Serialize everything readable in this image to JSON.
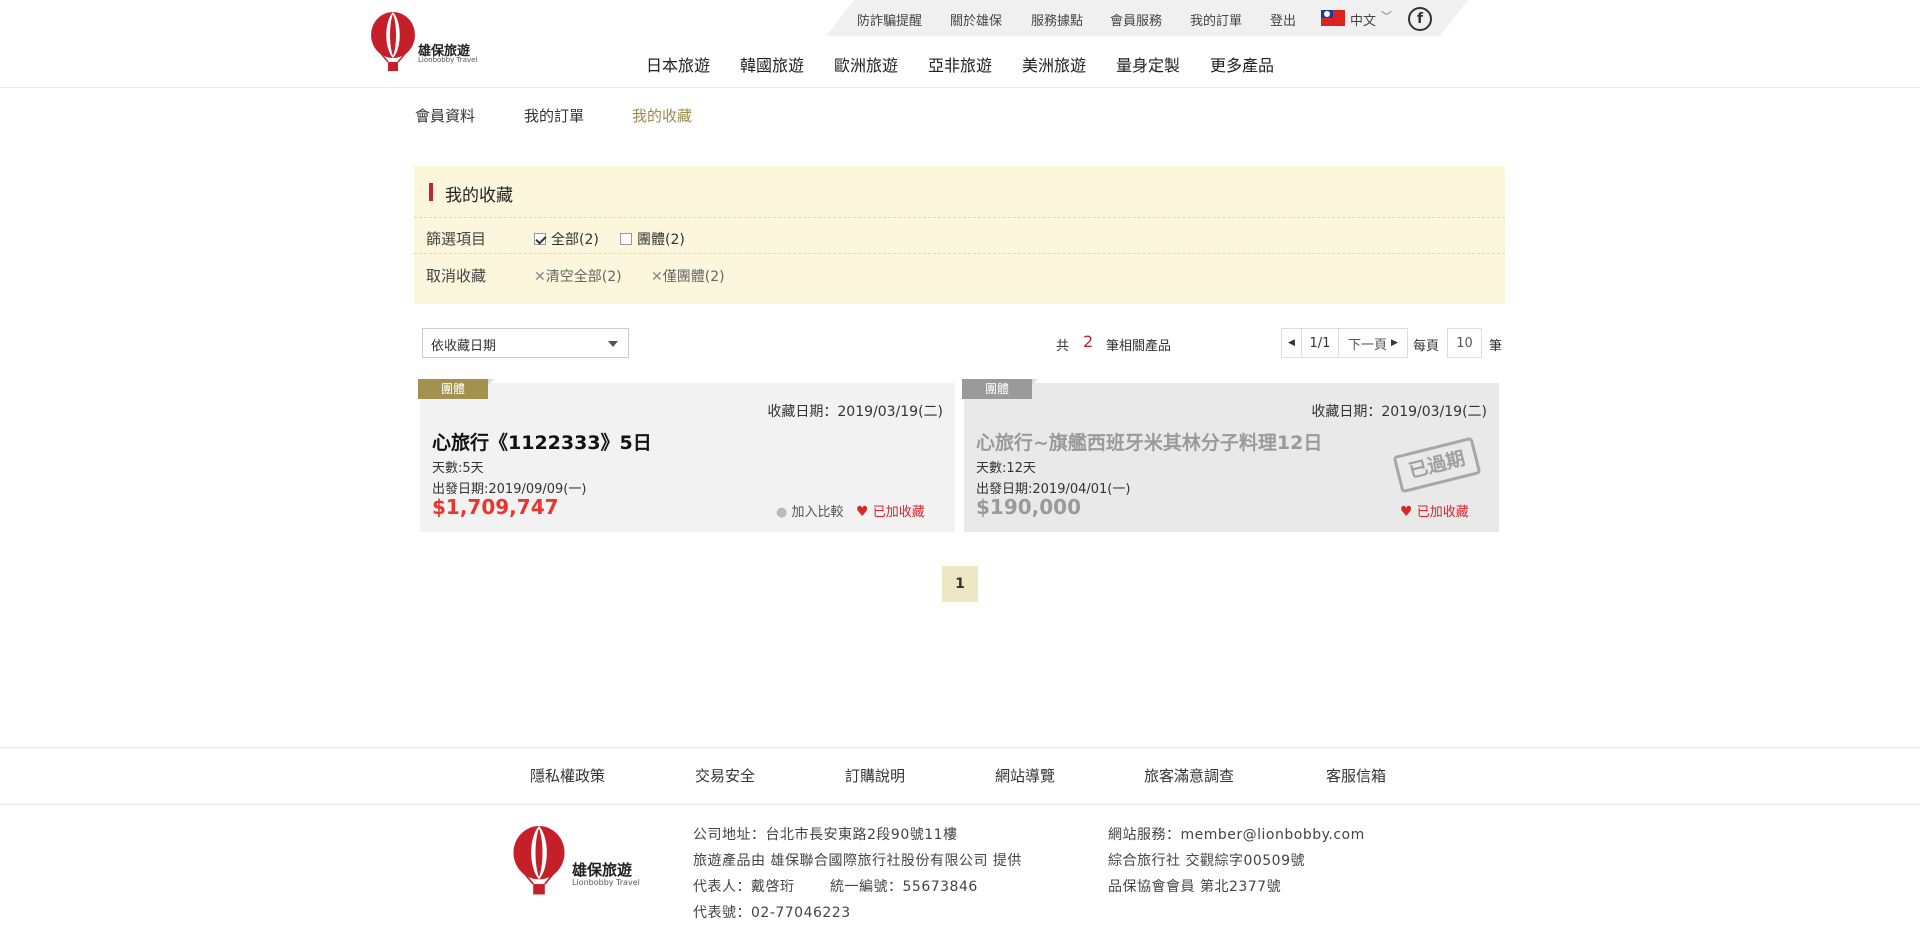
{
  "header": {
    "brand_name": "雄保旅遊",
    "brand_sub": "Lionbobby Travel",
    "top_links": [
      "防詐騙提醒",
      "關於雄保",
      "服務據點",
      "會員服務",
      "我的訂單",
      "登出"
    ],
    "language": "中文",
    "facebook_icon_text": "f",
    "nav": [
      "日本旅遊",
      "韓國旅遊",
      "歐洲旅遊",
      "亞非旅遊",
      "美洲旅遊",
      "量身定製",
      "更多產品"
    ]
  },
  "member_tabs": [
    "會員資料",
    "我的訂單",
    "我的收藏"
  ],
  "panel": {
    "title": "我的收藏",
    "filter_label": "篩選項目",
    "filter_options": [
      "全部(2)",
      "團體(2)"
    ],
    "cancel_label": "取消收藏",
    "cancel_options": [
      "清空全部(2)",
      "僅團體(2)"
    ]
  },
  "toolbar": {
    "sort_value": "依收藏日期",
    "total_prefix": "共",
    "total_count": "2",
    "total_suffix": "筆相關產品",
    "page": "1/1",
    "next": "下一頁",
    "per_page_prefix": "每頁",
    "per_page": "10",
    "per_page_suffix": "筆"
  },
  "cards": [
    {
      "tag": "團體",
      "date": "收藏日期：2019/03/19(二)",
      "title": "心旅行《1122333》5日",
      "days": "天數:5天",
      "depart": "出發日期:2019/09/09(一)",
      "price": "$1,709,747",
      "compare": "加入比較",
      "fav": "已加收藏"
    },
    {
      "tag": "團體",
      "date": "收藏日期：2019/03/19(二)",
      "title": "心旅行~旗艦西班牙米其林分子料理12日",
      "days": "天數:12天",
      "depart": "出發日期:2019/04/01(一)",
      "price": "$190,000",
      "fav": "已加收藏",
      "stamp": "已過期"
    }
  ],
  "pager": {
    "current": "1"
  },
  "footer": {
    "links": [
      "隱私權政策",
      "交易安全",
      "訂購說明",
      "網站導覽",
      "旅客滿意調查",
      "客服信箱"
    ],
    "address": "公司地址：台北市長安東路2段90號11樓",
    "provider": "旅遊產品由 雄保聯合國際旅行社股份有限公司 提供",
    "rep": "代表人：戴啓珩",
    "taxid": "統一編號：55673846",
    "phone": "代表號：02-77046223",
    "email": "網站服務：member@lionbobby.com",
    "license": "綜合旅行社 交觀綜字00509號",
    "assoc": "品保協會會員 第北2377號"
  },
  "colors": {
    "accent_gold": "#a08a4a",
    "tag_active": "#a3924f",
    "tag_expired": "#9a9a9a",
    "price_red": "#e8352e",
    "panel_bg": "#fcf6dd",
    "title_bar": "#c0272d"
  }
}
